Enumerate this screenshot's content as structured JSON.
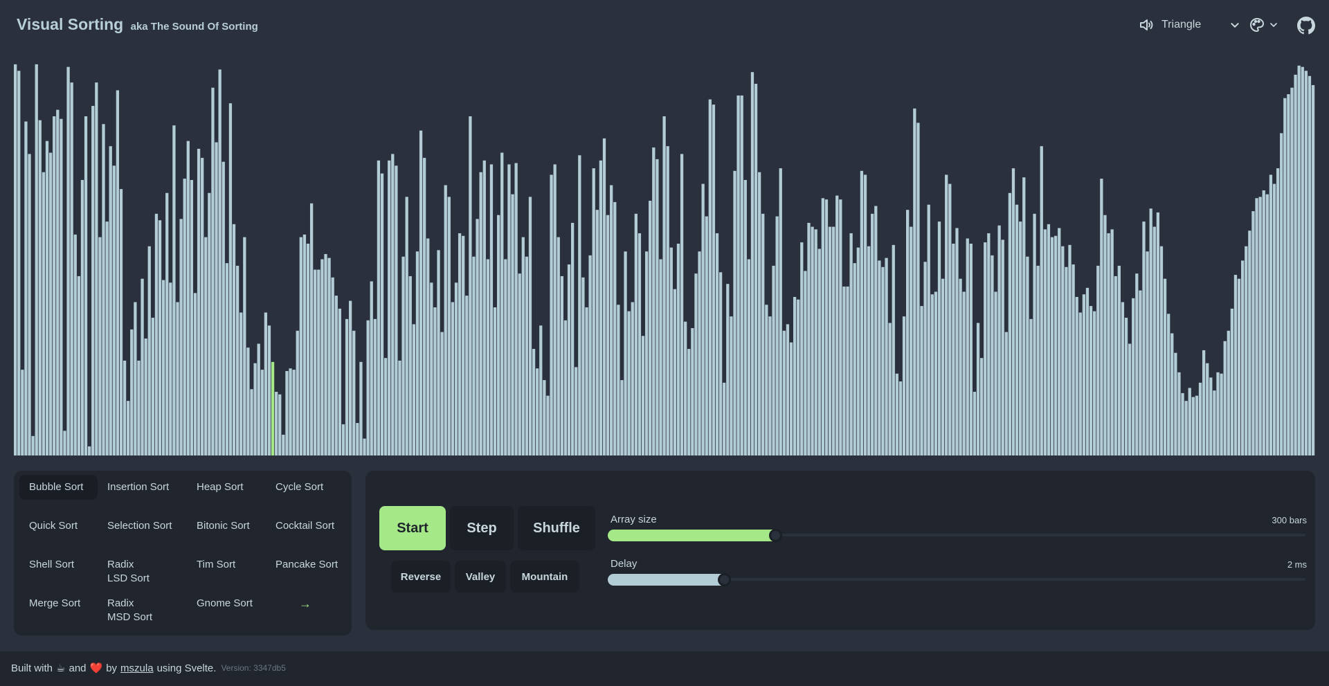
{
  "header": {
    "title": "Visual Sorting",
    "subtitle": "aka The Sound Of Sorting",
    "sound_type": "Triangle",
    "icons": [
      "speaker-icon",
      "chevron-down-icon",
      "palette-icon",
      "github-icon"
    ]
  },
  "visualization": {
    "bar_color": "#b3cdd6",
    "highlight_color": "#a5e887",
    "highlight_index": 73,
    "values": [
      301,
      296,
      66,
      257,
      232,
      15,
      301,
      258,
      218,
      242,
      233,
      261,
      266,
      259,
      19,
      299,
      287,
      170,
      138,
      212,
      261,
      7,
      269,
      287,
      168,
      255,
      180,
      238,
      223,
      281,
      205,
      73,
      42,
      97,
      118,
      73,
      136,
      90,
      161,
      106,
      186,
      181,
      135,
      202,
      133,
      254,
      118,
      182,
      213,
      242,
      212,
      125,
      236,
      229,
      168,
      202,
      283,
      241,
      297,
      226,
      148,
      271,
      178,
      146,
      110,
      168,
      83,
      51,
      71,
      86,
      66,
      110,
      100,
      72,
      49,
      47,
      16,
      65,
      67,
      66,
      96,
      168,
      170,
      163,
      194,
      143,
      143,
      151,
      155,
      152,
      137,
      123,
      113,
      24,
      105,
      119,
      96,
      25,
      72,
      13,
      104,
      134,
      105,
      227,
      217,
      75,
      227,
      232,
      223,
      73,
      153,
      199,
      138,
      101,
      157,
      250,
      229,
      167,
      133,
      114,
      158,
      95,
      208,
      199,
      118,
      133,
      171,
      169,
      123,
      261,
      153,
      182,
      218,
      227,
      151,
      224,
      114,
      185,
      233,
      151,
      224,
      201,
      225,
      140,
      168,
      153,
      199,
      82,
      67,
      100,
      58,
      46,
      216,
      224,
      168,
      138,
      104,
      147,
      179,
      68,
      231,
      137,
      114,
      154,
      221,
      189,
      227,
      244,
      185,
      208,
      195,
      116,
      58,
      157,
      111,
      118,
      186,
      171,
      92,
      157,
      196,
      237,
      228,
      151,
      261,
      238,
      160,
      128,
      163,
      232,
      103,
      82,
      98,
      140,
      157,
      209,
      184,
      274,
      270,
      171,
      141,
      56,
      132,
      107,
      219,
      277,
      277,
      212,
      151,
      295,
      286,
      218,
      186,
      116,
      107,
      146,
      184,
      221,
      96,
      101,
      87,
      122,
      120,
      164,
      142,
      179,
      176,
      174,
      159,
      198,
      197,
      176,
      176,
      200,
      197,
      130,
      130,
      171,
      148,
      160,
      219,
      216,
      161,
      186,
      192,
      150,
      145,
      152,
      102,
      162,
      63,
      57,
      107,
      189,
      176,
      267,
      256,
      115,
      149,
      193,
      124,
      126,
      180,
      136,
      216,
      209,
      163,
      175,
      136,
      126,
      167,
      163,
      49,
      102,
      75,
      164,
      171,
      154,
      126,
      177,
      166,
      95,
      202,
      221,
      193,
      180,
      214,
      153,
      105,
      186,
      146,
      238,
      174,
      178,
      168,
      169,
      175,
      161,
      145,
      162,
      147,
      122,
      110,
      124,
      129,
      115,
      111,
      146,
      213,
      185,
      171,
      174,
      138,
      146,
      118,
      106,
      86,
      121,
      140,
      127,
      180,
      157,
      190,
      176,
      187,
      161,
      136,
      109,
      94,
      79,
      64,
      48,
      42,
      52,
      45,
      46,
      56,
      81,
      71,
      60,
      50,
      64,
      63,
      88,
      96,
      113,
      139,
      136,
      150,
      161,
      173,
      188,
      198,
      199,
      204,
      201,
      216,
      209,
      221,
      248,
      275,
      278,
      283,
      293,
      300,
      299,
      296,
      292,
      285
    ],
    "ylim": [
      0,
      310
    ]
  },
  "algorithms": [
    [
      "Bubble Sort",
      "Insertion Sort",
      "Heap Sort",
      "Cycle Sort"
    ],
    [
      "Quick Sort",
      "Selection Sort",
      "Bitonic Sort",
      "Cocktail Sort"
    ],
    [
      "Shell Sort",
      "Radix\nLSD Sort",
      "Tim Sort",
      "Pancake Sort"
    ],
    [
      "Merge Sort",
      "Radix\nMSD Sort",
      "Gnome Sort",
      "→"
    ]
  ],
  "active_algorithm": "Bubble Sort",
  "controls": {
    "start": "Start",
    "step": "Step",
    "shuffle": "Shuffle",
    "reverse": "Reverse",
    "valley": "Valley",
    "mountain": "Mountain"
  },
  "sliders": {
    "array_size": {
      "label": "Array size",
      "value": "300 bars",
      "fraction": 0.24,
      "color": "#a5e887"
    },
    "delay": {
      "label": "Delay",
      "value": "2 ms",
      "fraction": 0.167,
      "color": "#b3cdd6"
    }
  },
  "footer": {
    "built_with": "Built with",
    "coffee": "☕",
    "and": "and",
    "heart": "❤️",
    "by": "by",
    "author": "mszula",
    "using": "using Svelte.",
    "version": "Version: 3347db5"
  }
}
